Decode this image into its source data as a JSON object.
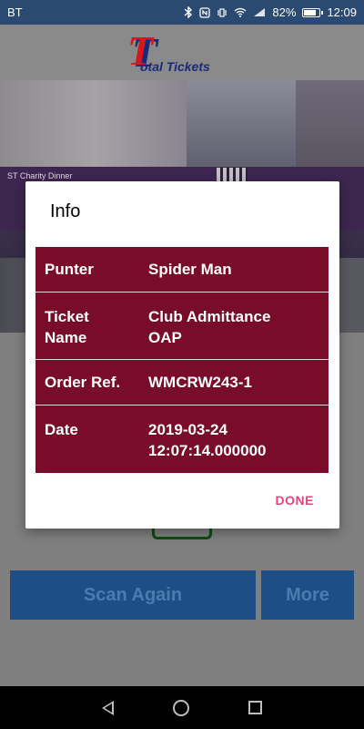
{
  "status_bar": {
    "carrier": "BT",
    "battery": "82%",
    "battery_level": 0.82,
    "time": "12:09",
    "icons": [
      "bluetooth-icon",
      "nfc-icon",
      "vibrate-icon",
      "wifi-icon",
      "signal-icon",
      "battery-icon"
    ]
  },
  "header": {
    "logo_letter": "T",
    "logo_word": "otal Tickets"
  },
  "banner": {
    "event_text": "ST Charity Dinner"
  },
  "dialog": {
    "title": "Info",
    "rows": [
      {
        "label": "Punter",
        "value": "Spider Man"
      },
      {
        "label": "Ticket\nName",
        "value": "Club Admittance\nOAP"
      },
      {
        "label": "Order Ref.",
        "value": "WMCRW243-1"
      },
      {
        "label": "Date",
        "value": "2019-03-24\n12:07:14.000000"
      }
    ],
    "done_label": "DONE"
  },
  "actions": {
    "scan_again_label": "Scan Again",
    "more_label": "More"
  },
  "colors": {
    "status_bar": "#2b4a72",
    "table_bg": "#790c28",
    "done_accent": "#e8457d",
    "button_bg": "#1d4f86",
    "logo_red": "#d4191e",
    "logo_blue": "#1a2a7a"
  }
}
